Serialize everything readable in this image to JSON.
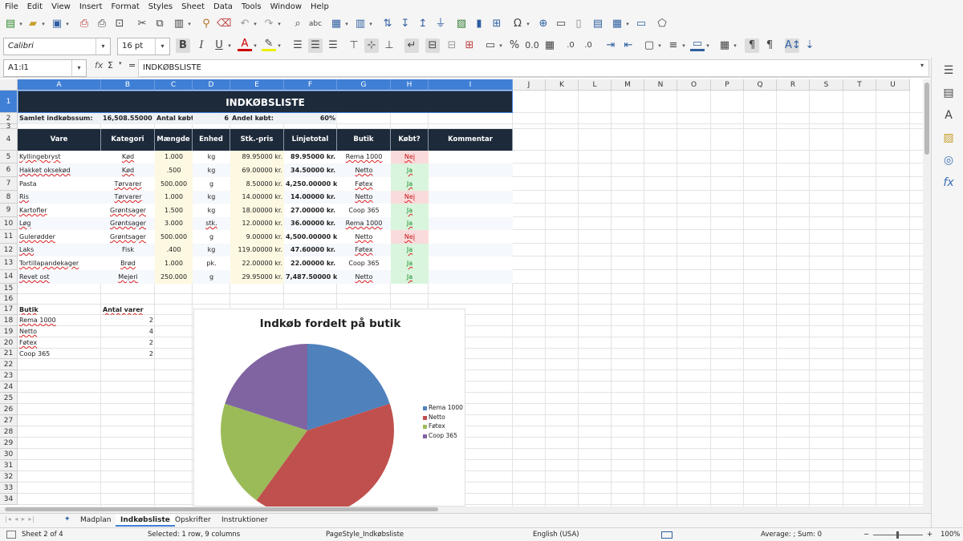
{
  "menu": [
    "File",
    "Edit",
    "View",
    "Insert",
    "Format",
    "Styles",
    "Sheet",
    "Data",
    "Tools",
    "Window",
    "Help"
  ],
  "toolbar": {
    "font_name": "Calibri",
    "font_size": "16 pt",
    "bold_label": "B",
    "italic_label": "I",
    "underline_label": "U"
  },
  "formula_bar": {
    "name_box": "A1:I1",
    "sigma": "Σ",
    "fx": "fx",
    "equals": "=",
    "content": "INDKØBSLISTE"
  },
  "columns": [
    "A",
    "B",
    "C",
    "D",
    "E",
    "F",
    "G",
    "H",
    "I",
    "J",
    "K",
    "L",
    "M",
    "N",
    "O",
    "P",
    "Q",
    "R",
    "S",
    "T",
    "U"
  ],
  "rows": [
    "1",
    "2",
    "3",
    "4",
    "5",
    "6",
    "7",
    "8",
    "9",
    "10",
    "11",
    "12",
    "13",
    "14",
    "15",
    "16",
    "17",
    "18",
    "19",
    "20",
    "21",
    "22",
    "23",
    "24",
    "25",
    "26",
    "27",
    "28",
    "29",
    "30",
    "31",
    "32",
    "33",
    "34"
  ],
  "sheet": {
    "title": "INDKØBSLISTE",
    "summary": {
      "total_label": "Samlet indkøbssum:",
      "total_value": "16,508.55000 kr.",
      "count_label": "Antal købt:",
      "count_value": "6",
      "share_label": "Andel købt:",
      "share_value": "60%"
    },
    "headers": [
      "Vare",
      "Kategori",
      "Mængde",
      "Enhed",
      "Stk.-pris",
      "Linjetotal",
      "Butik",
      "Købt?",
      "Kommentar"
    ],
    "items": [
      {
        "vare": "Kyllingebryst",
        "kategori": "Kød",
        "maengde": "1.000",
        "enhed": "kg",
        "pris": "89.95000 kr.",
        "total": "89.95000 kr.",
        "butik": "Rema 1000",
        "koebt": "Nej"
      },
      {
        "vare": "Hakket oksekød",
        "kategori": "Kød",
        "maengde": ".500",
        "enhed": "kg",
        "pris": "69.00000 kr.",
        "total": "34.50000 kr.",
        "butik": "Netto",
        "koebt": "Ja"
      },
      {
        "vare": "Pasta",
        "kategori": "Tørvarer",
        "maengde": "500.000",
        "enhed": "g",
        "pris": "8.50000 kr.",
        "total": "4,250.00000 kr.",
        "butik": "Føtex",
        "koebt": "Ja"
      },
      {
        "vare": "Ris",
        "kategori": "Tørvarer",
        "maengde": "1.000",
        "enhed": "kg",
        "pris": "14.00000 kr.",
        "total": "14.00000 kr.",
        "butik": "Netto",
        "koebt": "Nej"
      },
      {
        "vare": "Kartofler",
        "kategori": "Grøntsager",
        "maengde": "1.500",
        "enhed": "kg",
        "pris": "18.00000 kr.",
        "total": "27.00000 kr.",
        "butik": "Coop 365",
        "koebt": "Ja"
      },
      {
        "vare": "Løg",
        "kategori": "Grøntsager",
        "maengde": "3.000",
        "enhed": "stk.",
        "pris": "12.00000 kr.",
        "total": "36.00000 kr.",
        "butik": "Rema 1000",
        "koebt": "Ja"
      },
      {
        "vare": "Gulerødder",
        "kategori": "Grøntsager",
        "maengde": "500.000",
        "enhed": "g",
        "pris": "9.00000 kr.",
        "total": "4,500.00000 kr.",
        "butik": "Netto",
        "koebt": "Nej"
      },
      {
        "vare": "Laks",
        "kategori": "Fisk",
        "maengde": ".400",
        "enhed": "kg",
        "pris": "119.00000 kr.",
        "total": "47.60000 kr.",
        "butik": "Føtex",
        "koebt": "Ja"
      },
      {
        "vare": "Tortillapandekager",
        "kategori": "Brød",
        "maengde": "1.000",
        "enhed": "pk.",
        "pris": "22.00000 kr.",
        "total": "22.00000 kr.",
        "butik": "Coop 365",
        "koebt": "Ja"
      },
      {
        "vare": "Revet ost",
        "kategori": "Mejeri",
        "maengde": "250.000",
        "enhed": "g",
        "pris": "29.95000 kr.",
        "total": "7,487.50000 kr.",
        "butik": "Netto",
        "koebt": "Ja"
      }
    ],
    "store_table": {
      "header_butik": "Butik",
      "header_antal": "Antal varer",
      "rows": [
        {
          "butik": "Rema 1000",
          "antal": "2"
        },
        {
          "butik": "Netto",
          "antal": "4"
        },
        {
          "butik": "Føtex",
          "antal": "2"
        },
        {
          "butik": "Coop 365",
          "antal": "2"
        }
      ]
    }
  },
  "chart_data": {
    "type": "pie",
    "title": "Indkøb fordelt på butik",
    "categories": [
      "Rema 1000",
      "Netto",
      "Føtex",
      "Coop 365"
    ],
    "values": [
      2,
      4,
      2,
      2
    ],
    "colors": [
      "#4f81bd",
      "#c0504d",
      "#9bbb59",
      "#8064a2"
    ],
    "legend_position": "right"
  },
  "tabs": [
    "Madplan",
    "Indkøbsliste",
    "Opskrifter",
    "Instruktioner"
  ],
  "active_tab": "Indkøbsliste",
  "status": {
    "sheet": "Sheet 2 of 4",
    "selection": "Selected: 1 row, 9 columns",
    "page_style": "PageStyle_Indkøbsliste",
    "language": "English (USA)",
    "aggregate": "Average: ; Sum: 0",
    "zoom": "100%"
  },
  "colors": {
    "header_dark": "#1d2a3a",
    "selection_blue": "#3f7fd6",
    "nej_bg": "#fadbdb",
    "ja_bg": "#d9f5dd"
  }
}
